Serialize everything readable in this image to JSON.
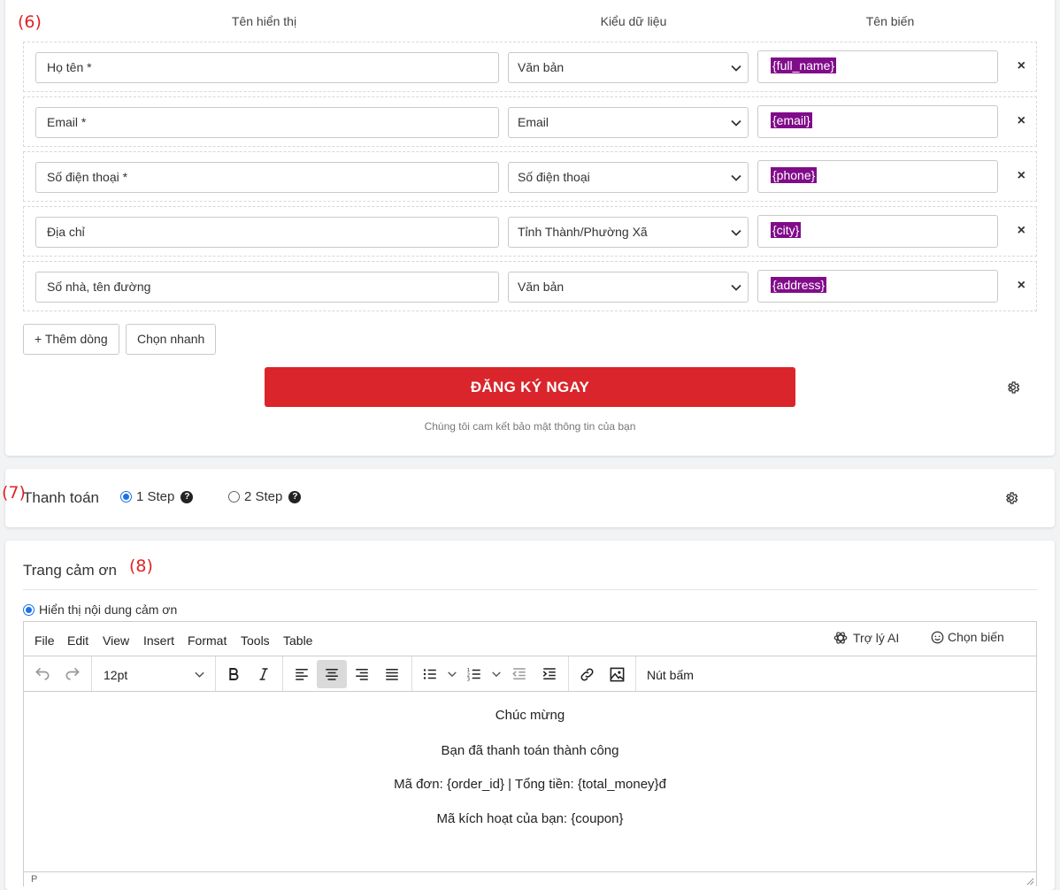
{
  "form_section": {
    "annotation": "(6)",
    "col_display": "Tên hiển thị",
    "col_type": "Kiểu dữ liệu",
    "col_var": "Tên biến",
    "rows": [
      {
        "name": "Họ tên *",
        "type": "Văn bản",
        "var": "{full_name}"
      },
      {
        "name": "Email *",
        "type": "Email",
        "var": "{email}"
      },
      {
        "name": "Số điện thoại *",
        "type": "Số điện thoại",
        "var": "{phone}"
      },
      {
        "name": "Địa chỉ",
        "type": "Tỉnh Thành/Phường Xã",
        "var": "{city}"
      },
      {
        "name": "Số nhà, tên đường",
        "type": "Văn bản",
        "var": "{address}"
      }
    ],
    "remove_symbol": "×",
    "add_row": "+ Thêm dòng",
    "quick_pick": "Chọn nhanh",
    "submit": "ĐĂNG KÝ NGAY",
    "privacy": "Chúng tôi cam kết bảo mật thông tin của bạn"
  },
  "payment_section": {
    "annotation": "(7)",
    "title": "Thanh toán",
    "option1": "1 Step",
    "option2": "2 Step",
    "help_mark": "?"
  },
  "thanks_section": {
    "title": "Trang cảm ơn",
    "annotation": "(8)",
    "show_content": "Hiển thị nội dung cảm ơn",
    "menu": [
      "File",
      "Edit",
      "View",
      "Insert",
      "Format",
      "Tools",
      "Table"
    ],
    "ai_assistant": "Trợ lý AI",
    "choose_var": "Chọn biến",
    "font_size": "12pt",
    "button_label": "Nút bấm",
    "content_lines": [
      "Chúc mừng",
      "Bạn đã thanh toán thành công",
      "Mã đơn: {order_id} | Tổng tiền: {total_money}đ",
      "Mã kích hoạt của bạn: {coupon}"
    ],
    "status_path": "P"
  },
  "colors": {
    "accent_red": "#d9252b",
    "var_tag_bg": "#800c8a",
    "radio_blue": "#1a73e8",
    "annotation_red": "#e02424"
  }
}
